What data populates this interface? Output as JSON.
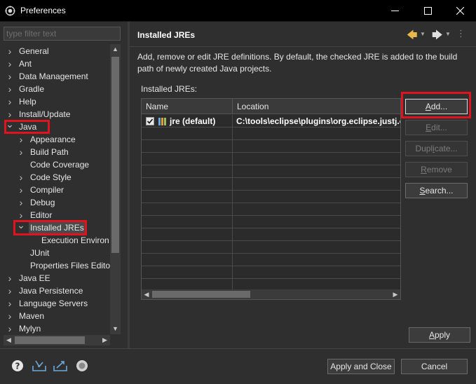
{
  "window": {
    "title": "Preferences"
  },
  "filter": {
    "placeholder": "type filter text"
  },
  "tree": [
    {
      "label": "General",
      "level": 0,
      "arrow": "right"
    },
    {
      "label": "Ant",
      "level": 0,
      "arrow": "right"
    },
    {
      "label": "Data Management",
      "level": 0,
      "arrow": "right"
    },
    {
      "label": "Gradle",
      "level": 0,
      "arrow": "right"
    },
    {
      "label": "Help",
      "level": 0,
      "arrow": "right"
    },
    {
      "label": "Install/Update",
      "level": 0,
      "arrow": "right"
    },
    {
      "label": "Java",
      "level": 0,
      "arrow": "down"
    },
    {
      "label": "Appearance",
      "level": 1,
      "arrow": "right"
    },
    {
      "label": "Build Path",
      "level": 1,
      "arrow": "right"
    },
    {
      "label": "Code Coverage",
      "level": 1,
      "arrow": "none"
    },
    {
      "label": "Code Style",
      "level": 1,
      "arrow": "right"
    },
    {
      "label": "Compiler",
      "level": 1,
      "arrow": "right"
    },
    {
      "label": "Debug",
      "level": 1,
      "arrow": "right"
    },
    {
      "label": "Editor",
      "level": 1,
      "arrow": "right"
    },
    {
      "label": "Installed JREs",
      "level": 1,
      "arrow": "down",
      "selected": true
    },
    {
      "label": "Execution Environ",
      "level": 2,
      "arrow": "none"
    },
    {
      "label": "JUnit",
      "level": 1,
      "arrow": "none"
    },
    {
      "label": "Properties Files Editor",
      "level": 1,
      "arrow": "none"
    },
    {
      "label": "Java EE",
      "level": 0,
      "arrow": "right"
    },
    {
      "label": "Java Persistence",
      "level": 0,
      "arrow": "right"
    },
    {
      "label": "Language Servers",
      "level": 0,
      "arrow": "right"
    },
    {
      "label": "Maven",
      "level": 0,
      "arrow": "right"
    },
    {
      "label": "Mylyn",
      "level": 0,
      "arrow": "right"
    }
  ],
  "page": {
    "title": "Installed JREs",
    "description": "Add, remove or edit JRE definitions. By default, the checked JRE is added to the build path of newly created Java projects.",
    "list_label": "Installed JREs:"
  },
  "table": {
    "columns": [
      "Name",
      "Location"
    ],
    "rows": [
      {
        "checked": true,
        "name": "jre (default)",
        "location": "C:\\tools\\eclipse\\plugins\\org.eclipse.justj.op"
      }
    ],
    "empty_rows": 13
  },
  "buttons": {
    "add": {
      "pre": "",
      "mn": "A",
      "post": "dd..."
    },
    "edit": {
      "pre": "",
      "mn": "E",
      "post": "dit..."
    },
    "duplicate": {
      "pre": "Dupl",
      "mn": "i",
      "post": "cate..."
    },
    "remove": {
      "pre": "",
      "mn": "R",
      "post": "emove"
    },
    "search": {
      "pre": "",
      "mn": "S",
      "post": "earch..."
    },
    "apply": {
      "pre": "",
      "mn": "A",
      "post": "pply"
    },
    "apply_close": "Apply and Close",
    "cancel": "Cancel"
  },
  "colors": {
    "highlight": "#e0141e",
    "background": "#2f2f2f",
    "title_bar": "#000000",
    "back_arrow": "#e8b84a"
  },
  "icons": [
    "eclipse-app-icon",
    "minimize-icon",
    "maximize-icon",
    "close-icon",
    "back-arrow-icon",
    "forward-arrow-icon",
    "view-menu-icon",
    "jre-library-icon",
    "help-icon",
    "import-icon",
    "export-icon",
    "oomph-record-icon"
  ]
}
